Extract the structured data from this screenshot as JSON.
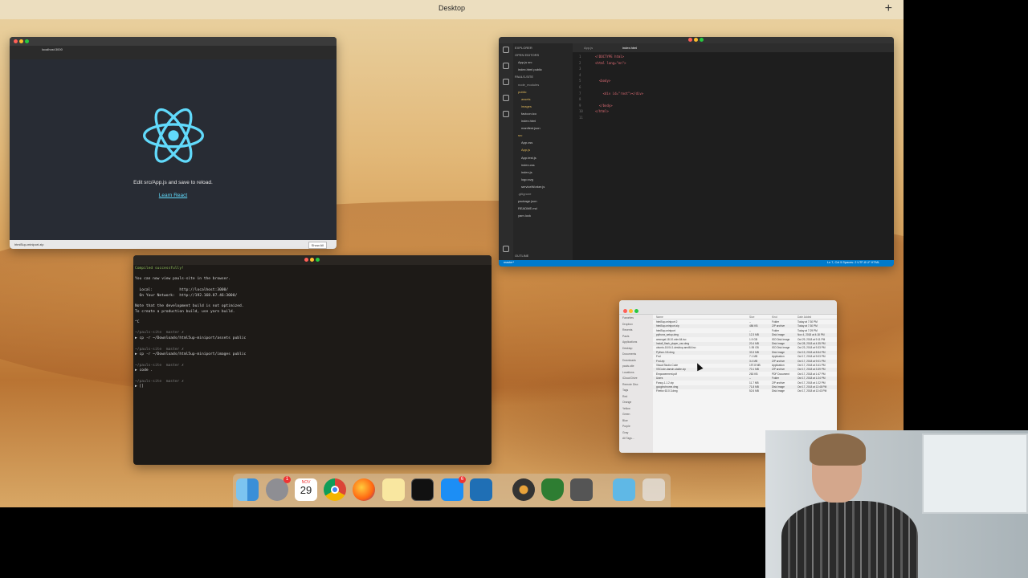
{
  "mission_control": {
    "title": "Desktop",
    "add_symbol": "+"
  },
  "browser": {
    "url": "localhost:3000",
    "edit_text": "Edit src/App.js and save to reload.",
    "learn_link": "Learn React",
    "download_item": "htmlSup-miniport.zip",
    "show_all": "Show All"
  },
  "vscode": {
    "tabs": [
      "App.js",
      "index.html"
    ],
    "sidebar": [
      {
        "text": "EXPLORER",
        "color": "#bbbbbb"
      },
      {
        "text": "OPEN EDITORS",
        "color": "#bbbbbb"
      },
      {
        "text": "App.js src",
        "color": "#cccccc"
      },
      {
        "text": "index.html public",
        "color": "#cccccc"
      },
      {
        "text": "PAULS-SITE",
        "color": "#bbbbbb"
      },
      {
        "text": "node_modules",
        "color": "#9a9a9a"
      },
      {
        "text": "public",
        "color": "#e0b85a"
      },
      {
        "text": "assets",
        "color": "#e0b85a"
      },
      {
        "text": "images",
        "color": "#e0b85a"
      },
      {
        "text": "favicon.ico",
        "color": "#cccccc"
      },
      {
        "text": "index.html",
        "color": "#cccccc"
      },
      {
        "text": "manifest.json",
        "color": "#cccccc"
      },
      {
        "text": "src",
        "color": "#e0b85a"
      },
      {
        "text": "App.css",
        "color": "#cccccc"
      },
      {
        "text": "App.js",
        "color": "#e0b85a"
      },
      {
        "text": "App.test.js",
        "color": "#cccccc"
      },
      {
        "text": "index.css",
        "color": "#cccccc"
      },
      {
        "text": "index.js",
        "color": "#cccccc"
      },
      {
        "text": "logo.svg",
        "color": "#cccccc"
      },
      {
        "text": "serviceWorker.js",
        "color": "#cccccc"
      },
      {
        "text": ".gitignore",
        "color": "#9a9a9a"
      },
      {
        "text": "package.json",
        "color": "#cccccc"
      },
      {
        "text": "README.md",
        "color": "#cccccc"
      },
      {
        "text": "yarn.lock",
        "color": "#cccccc"
      },
      {
        "text": "OUTLINE",
        "color": "#bbbbbb"
      }
    ],
    "code": [
      "<!DOCTYPE html>",
      "<html lang=\"en\">",
      "",
      "",
      "  <body>",
      "",
      "    <div id=\"root\"></div>",
      "",
      "  </body>",
      "</html>",
      ""
    ],
    "status_left": "master*",
    "status_right": "Ln 7, Col 5   Spaces: 2   UTF-8   LF   HTML"
  },
  "terminal": {
    "lines": [
      {
        "text": "Compiled successfully!",
        "color": "#8fbf5c"
      },
      {
        "text": "",
        "color": "#d9d9d9"
      },
      {
        "text": "You can now view pauls-site in the browser.",
        "color": "#d9d9d9"
      },
      {
        "text": "",
        "color": "#d9d9d9"
      },
      {
        "text": "  Local:            http://localhost:3000/",
        "color": "#d9d9d9"
      },
      {
        "text": "  On Your Network:  http://192.168.87.46:3000/",
        "color": "#d9d9d9"
      },
      {
        "text": "",
        "color": "#d9d9d9"
      },
      {
        "text": "Note that the development build is not optimized.",
        "color": "#d9d9d9"
      },
      {
        "text": "To create a production build, use yarn build.",
        "color": "#d9d9d9"
      },
      {
        "text": "",
        "color": "#d9d9d9"
      },
      {
        "text": "^C",
        "color": "#d9d9d9"
      },
      {
        "text": "",
        "color": "#d9d9d9"
      },
      {
        "text": "~/pauls-site  master ✗",
        "color": "#7f7f7f"
      },
      {
        "text": "▶ cp -r ~/Downloads/html5up-miniport/assets public",
        "color": "#d9d9d9"
      },
      {
        "text": "",
        "color": "#d9d9d9"
      },
      {
        "text": "~/pauls-site  master ✗",
        "color": "#7f7f7f"
      },
      {
        "text": "▶ cp -r ~/Downloads/html5up-miniport/images public",
        "color": "#d9d9d9"
      },
      {
        "text": "",
        "color": "#d9d9d9"
      },
      {
        "text": "~/pauls-site  master ✗",
        "color": "#7f7f7f"
      },
      {
        "text": "▶ code .",
        "color": "#d9d9d9"
      },
      {
        "text": "",
        "color": "#d9d9d9"
      },
      {
        "text": "~/pauls-site  master ✗",
        "color": "#7f7f7f"
      },
      {
        "text": "▶ []",
        "color": "#d9d9d9"
      }
    ]
  },
  "finder": {
    "sidebar": [
      "Favorites",
      "Dropbox",
      "Recents",
      "Pauls",
      "Applications",
      "Desktop",
      "Documents",
      "Downloads",
      "pauls-site",
      "Locations",
      "iCloud Drive",
      "Remote Disc",
      "Tags",
      "Red",
      "Orange",
      "Yellow",
      "Green",
      "Blue",
      "Purple",
      "Gray",
      "All Tags..."
    ],
    "columns": [
      "Name",
      "Size",
      "Kind",
      "Date Added"
    ],
    "files": [
      {
        "name": "html5up-miniport 2",
        "size": "--",
        "kind": "Folder",
        "date": "Today at 7:30 PM"
      },
      {
        "name": "html5up-miniport.zip",
        "size": "486 KB",
        "kind": "ZIP archive",
        "date": "Today at 7:30 PM"
      },
      {
        "name": "html5up-miniport",
        "size": "--",
        "kind": "Folder",
        "date": "Today at 7:29 PM"
      },
      {
        "name": "pythonx_setup.dmg",
        "size": "12.3 MB",
        "kind": "Disk Image",
        "date": "Nov 4, 2018 at 4:18 PM"
      },
      {
        "name": "amongst.18.10.vdm.64.iso",
        "size": "1.9 GB",
        "kind": "ISO Disk Image",
        "date": "Oct 29, 2018 at 9:11 PM"
      },
      {
        "name": "Install_flash_player_osx.dmg",
        "size": "20.4 MB",
        "kind": "Disk Image",
        "date": "Oct 28, 2018 at 4:35 PM"
      },
      {
        "name": "ubuntu-18.04.1-desktop-amd64.iso",
        "size": "1.95 GB",
        "kind": "ISO Disk Image",
        "date": "Oct 23, 2018 at 9:33 PM"
      },
      {
        "name": "Python-3.8.dmg",
        "size": "33.3 MB",
        "kind": "Disk Image",
        "date": "Oct 19, 2018 at 8:54 PM"
      },
      {
        "name": "Fnd",
        "size": "7.1 MB",
        "kind": "Application",
        "date": "Oct 17, 2018 at 9:03 PM"
      },
      {
        "name": "Fnd.zip",
        "size": "3.4 MB",
        "kind": "ZIP archive",
        "date": "Oct 17, 2018 at 9:01 PM"
      },
      {
        "name": "Visual Studio Code",
        "size": "197.8 MB",
        "kind": "Application",
        "date": "Oct 17, 2018 at 3:41 PM"
      },
      {
        "name": "VSCode-darwin-stable.zip",
        "size": "70.1 MB",
        "kind": "ZIP archive",
        "date": "Oct 17, 2018 at 3:39 PM"
      },
      {
        "name": "Empowerment.pdf",
        "size": "263 KB",
        "kind": "PDF Document",
        "date": "Oct 17, 2018 at 1:47 PM"
      },
      {
        "name": "Users",
        "size": "--",
        "kind": "Folder",
        "date": "Oct 17, 2018 at 1:24 PM"
      },
      {
        "name": "Fancy-1.1.2.zip",
        "size": "11.7 MB",
        "kind": "ZIP archive",
        "date": "Oct 17, 2018 at 1:22 PM"
      },
      {
        "name": "googlechrome.dmg",
        "size": "71.8 MB",
        "kind": "Disk Image",
        "date": "Oct 17, 2018 at 12:48 PM"
      },
      {
        "name": "Firefox 63.0.3.dmg",
        "size": "52.6 MB",
        "kind": "Disk Image",
        "date": "Oct 17, 2018 at 12:43 PM"
      }
    ]
  },
  "dock": {
    "calendar_month": "NOV",
    "calendar_day": "29",
    "badge_settings": "1",
    "badge_appstore": "6",
    "icons": [
      "finder-icon",
      "system-preferences-icon",
      "calendar-icon",
      "chrome-icon",
      "firefox-icon",
      "notes-icon",
      "terminal-icon",
      "app-store-icon",
      "vscode-icon",
      "itunes-icon",
      "vpn-icon",
      "calculator-icon",
      "folder-icon",
      "trash-icon"
    ]
  }
}
